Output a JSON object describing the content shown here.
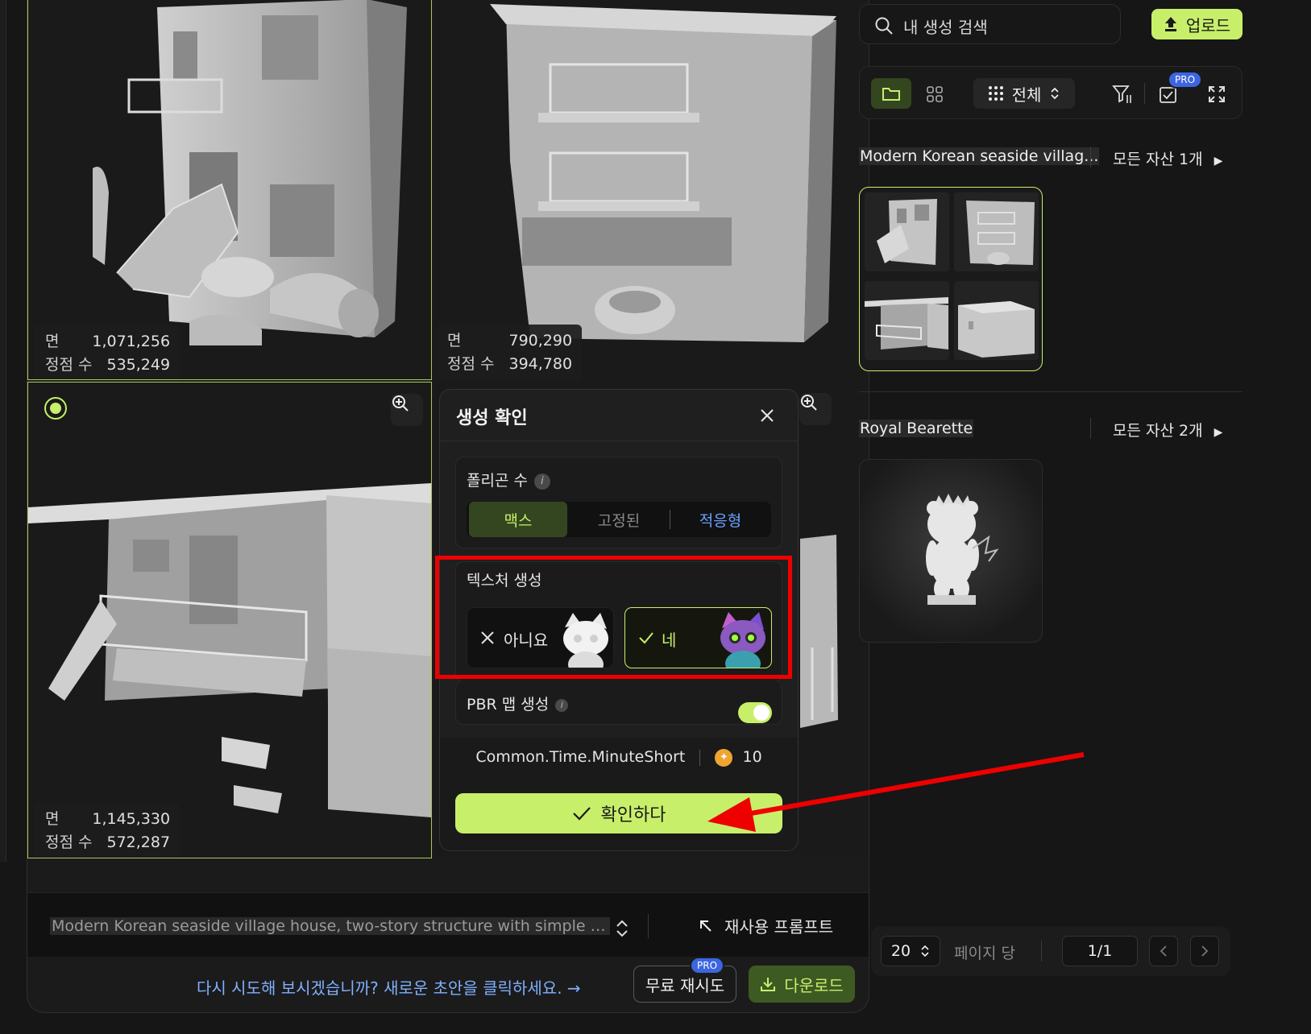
{
  "gallery": {
    "cards": [
      {
        "faces_label": "면",
        "faces": "1,071,256",
        "vertices_label": "정점 수",
        "vertices": "535,249"
      },
      {
        "faces_label": "면",
        "faces": "790,290",
        "vertices_label": "정점 수",
        "vertices": "394,780"
      },
      {
        "faces_label": "면",
        "faces": "1,145,330",
        "vertices_label": "정점 수",
        "vertices": "572,287"
      }
    ],
    "prompt": "Modern Korean seaside village house, two-story structure with simple boxy ...",
    "reuse_prompt": "재사용 프롬프트",
    "retry_text": "다시 시도해 보시겠습니까? 새로운 초안을 클릭하세요. →",
    "free_retry": "무료 재시도",
    "pro_badge": "PRO",
    "download": "다운로드"
  },
  "dialog": {
    "title": "생성 확인",
    "polygon_label": "폴리곤 수",
    "polygon_options": [
      "맥스",
      "고정된",
      "적응형"
    ],
    "polygon_selected": "맥스",
    "texture_label": "텍스처 생성",
    "texture_no": "아니요",
    "texture_yes": "네",
    "texture_selected": "네",
    "pbr_label": "PBR 맵 생성",
    "pbr_enabled": true,
    "time": "Common.Time.MinuteShort",
    "credits": "10",
    "confirm": "확인하다"
  },
  "sidebar": {
    "search_placeholder": "내 생성 검색",
    "upload": "업로드",
    "filter_all": "전체",
    "pro_badge": "PRO",
    "groups": [
      {
        "title": "Modern Korean seaside villag...",
        "count": "모든 자산 1개"
      },
      {
        "title": "Royal Bearette",
        "count": "모든 자산 2개"
      }
    ],
    "per_page": "20",
    "per_page_label": "페이지 당",
    "page": "1/1"
  },
  "colors": {
    "accent": "#c8ef6a",
    "highlight": "#ee0000",
    "link": "#7fb0ff",
    "pro": "#3c66e0"
  }
}
